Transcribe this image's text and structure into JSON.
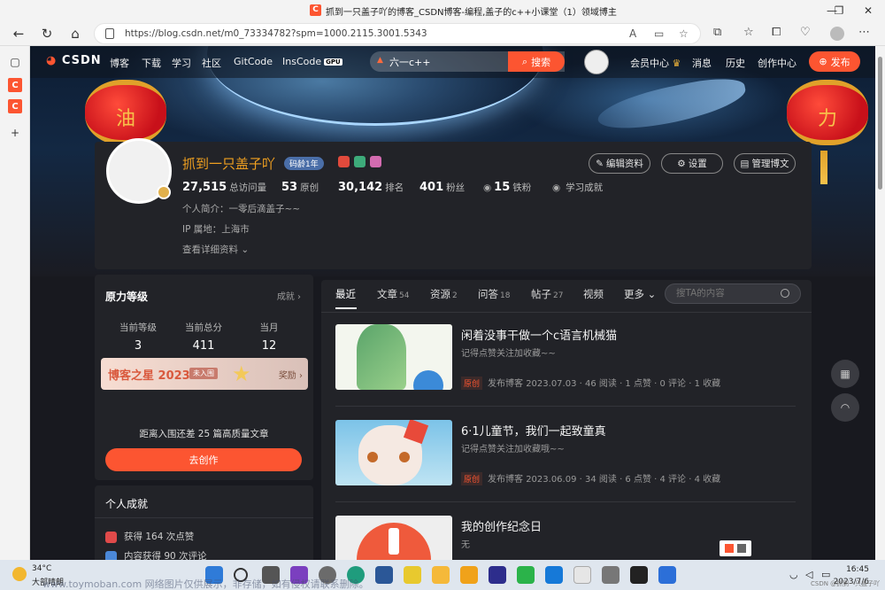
{
  "window": {
    "title": "抓到一只盖子吖的博客_CSDN博客-编程,盖子的c++小课堂（1）领域博主",
    "minimize": "—",
    "maximize": "❐",
    "close": "✕"
  },
  "browser": {
    "url": "https://blog.csdn.net/m0_73334782?spm=1000.2115.3001.5343",
    "read_aloud": "A",
    "sidebar_c": "C"
  },
  "nav": {
    "logo": "CSDN",
    "links": [
      "博客",
      "下载",
      "学习",
      "社区",
      "GitCode",
      "InsCode"
    ],
    "gpu_badge": "GPU",
    "search_value": "六一c++",
    "search_button": "搜索",
    "right_links": [
      "会员中心",
      "消息",
      "历史",
      "创作中心"
    ],
    "publish_button": "发布"
  },
  "lanterns": {
    "left": "油",
    "right": "力"
  },
  "profile": {
    "name": "抓到一只盖子吖",
    "code_age": "码龄1年",
    "edit_button": "编辑资料",
    "settings_button": "设置",
    "manage_button": "管理博文",
    "stats": [
      {
        "value": "27,515",
        "label": "总访问量"
      },
      {
        "value": "53",
        "label": "原创"
      },
      {
        "value": "30,142",
        "label": "排名"
      },
      {
        "value": "401",
        "label": "粉丝"
      },
      {
        "value": "15",
        "label": "铁粉"
      }
    ],
    "learning": "学习成就",
    "bio": "个人简介：一零后滴盖子~~",
    "ip": "IP 属地：上海市",
    "details": "查看详细资料"
  },
  "level": {
    "title": "原力等级",
    "link": "成就",
    "cols": [
      {
        "label": "当前等级",
        "value": "3"
      },
      {
        "label": "当前总分",
        "value": "411"
      },
      {
        "label": "当月",
        "value": "12"
      }
    ],
    "star_title": "博客之星 2023",
    "star_tag": "未入围",
    "star_reward": "奖励",
    "progress_text": "距离入围还差 25 篇高质量文章",
    "create_button": "去创作"
  },
  "achievements": {
    "title": "个人成就",
    "rows": [
      "获得 164 次点赞",
      "内容获得 90 次评论"
    ]
  },
  "feed": {
    "tabs": [
      {
        "label": "最近",
        "count": ""
      },
      {
        "label": "文章",
        "count": "54"
      },
      {
        "label": "资源",
        "count": "2"
      },
      {
        "label": "问答",
        "count": "18"
      },
      {
        "label": "帖子",
        "count": "27"
      },
      {
        "label": "视频",
        "count": ""
      },
      {
        "label": "更多",
        "count": ""
      }
    ],
    "search_placeholder": "搜TA的内容",
    "articles": [
      {
        "title": "闲着没事干做一个c语言机械猫",
        "desc": "记得点赞关注加收藏~~",
        "tag": "原创",
        "meta": "发布博客 2023.07.03 · 46 阅读 · 1 点赞 · 0 评论 · 1 收藏"
      },
      {
        "title": "6·1儿童节，我们一起致童真",
        "desc": "记得点赞关注加收藏哦~~",
        "tag": "原创",
        "meta": "发布博客 2023.06.09 · 34 阅读 · 6 点赞 · 4 评论 · 4 收藏"
      },
      {
        "title": "我的创作纪念日",
        "desc": "无",
        "tag": "",
        "meta": ""
      }
    ]
  },
  "taskbar": {
    "temp": "34°C",
    "weather": "大部晴朗",
    "time": "16:45",
    "date": "2023/7/6"
  },
  "watermarks": {
    "center": "www.toymoban.com 网络图片仅供展示，非存储，如有侵权请联系删除。",
    "corner": "CSDN @抓到一只盖子吖"
  }
}
